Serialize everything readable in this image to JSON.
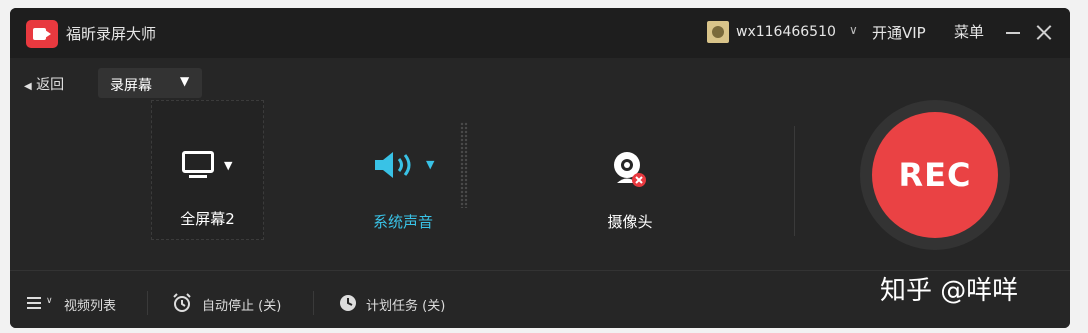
{
  "titlebar": {
    "app_title": "福昕录屏大师",
    "user_name": "wx116466510",
    "vip_label": "开通VIP",
    "menu_label": "菜单"
  },
  "toolbar": {
    "back_label": "返回",
    "mode_select": "录屏幕"
  },
  "sources": {
    "screen_label": "全屏幕2",
    "audio_label": "系统声音",
    "camera_label": "摄像头"
  },
  "rec_button_label": "REC",
  "bottombar": {
    "video_list": "视频列表",
    "auto_stop": "自动停止 (关)",
    "schedule": "计划任务 (关)"
  },
  "watermark": "知乎 @咩咩",
  "colors": {
    "accent": "#39c2e6",
    "rec": "#ea4244",
    "background": "#262626"
  }
}
